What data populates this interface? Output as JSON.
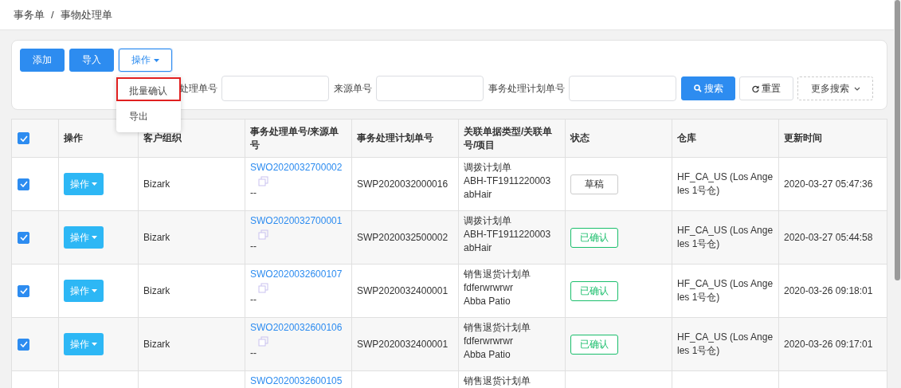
{
  "breadcrumb": [
    "事务单",
    "事物处理单"
  ],
  "breadcrumb_separator": "/",
  "toolbar": {
    "buttons": [
      {
        "label": "添加",
        "kind": "primary"
      },
      {
        "label": "导入",
        "kind": "primary"
      },
      {
        "label": "操作",
        "kind": "dropdown"
      }
    ]
  },
  "dropdown_menu": [
    {
      "label": "批量确认",
      "highlighted": true
    },
    {
      "label": "导出",
      "highlighted": false
    }
  ],
  "filters": [
    {
      "label": "处理单号"
    },
    {
      "label": "来源单号"
    },
    {
      "label": "事务处理计划单号"
    }
  ],
  "filter_buttons": [
    {
      "label": "搜索",
      "kind": "search"
    },
    {
      "label": "重置",
      "kind": "reset"
    },
    {
      "label": "更多搜索",
      "kind": "more"
    }
  ],
  "table": {
    "select_all": true,
    "columns": [
      "操作",
      "客户组织",
      "事务处理单号/来源单号",
      "事务处理计划单号",
      "关联单据类型/关联单号/项目",
      "状态",
      "仓库",
      "更新时间"
    ],
    "rows": [
      {
        "checked": true,
        "action": "操作",
        "customer": "Bizark",
        "order_no": "SWO2020032700002",
        "source_no": "--",
        "plan_no": "SWP2020032000016",
        "ref_type": "调拨计划单",
        "ref_no": "ABH-TF1911220003",
        "project": "abHair",
        "status": {
          "label": "草稿",
          "kind": "draft"
        },
        "warehouse": "HF_CA_US (Los Angeles 1号仓)",
        "updated": "2020-03-27 05:47:36"
      },
      {
        "checked": true,
        "action": "操作",
        "customer": "Bizark",
        "order_no": "SWO2020032700001",
        "source_no": "--",
        "plan_no": "SWP2020032500002",
        "ref_type": "调拨计划单",
        "ref_no": "ABH-TF1911220003",
        "project": "abHair",
        "status": {
          "label": "已确认",
          "kind": "confirmed"
        },
        "warehouse": "HF_CA_US (Los Angeles 1号仓)",
        "updated": "2020-03-27 05:44:58"
      },
      {
        "checked": true,
        "action": "操作",
        "customer": "Bizark",
        "order_no": "SWO2020032600107",
        "source_no": "--",
        "plan_no": "SWP2020032400001",
        "ref_type": "销售退货计划单",
        "ref_no": "fdferwrwrwr",
        "project": "Abba Patio",
        "status": {
          "label": "已确认",
          "kind": "confirmed"
        },
        "warehouse": "HF_CA_US (Los Angeles 1号仓)",
        "updated": "2020-03-26 09:18:01"
      },
      {
        "checked": true,
        "action": "操作",
        "customer": "Bizark",
        "order_no": "SWO2020032600106",
        "source_no": "--",
        "plan_no": "SWP2020032400001",
        "ref_type": "销售退货计划单",
        "ref_no": "fdferwrwrwr",
        "project": "Abba Patio",
        "status": {
          "label": "已确认",
          "kind": "confirmed"
        },
        "warehouse": "HF_CA_US (Los Angeles 1号仓)",
        "updated": "2020-03-26 09:17:01"
      },
      {
        "order_no": "SWO2020032600105",
        "ref_type": "销售退货计划单"
      }
    ]
  }
}
